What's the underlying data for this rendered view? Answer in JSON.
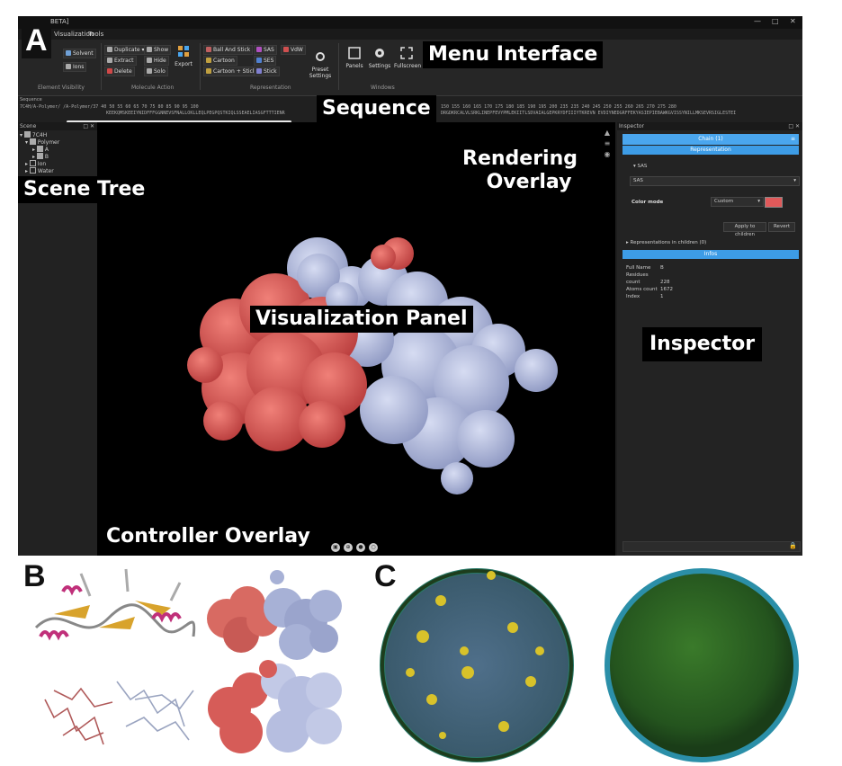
{
  "title_fragment": "BETA]",
  "menu": [
    "Visualization",
    "Tools"
  ],
  "ribbon": {
    "groups": [
      "Element Visibility",
      "Molecule Action",
      "Representation",
      "Windows"
    ],
    "element_visibility": [
      "Solvent",
      "Ions"
    ],
    "molecule_action": [
      "Duplicate",
      "Extract",
      "Delete",
      "Show",
      "Hide",
      "Solo",
      "Export"
    ],
    "representation": [
      "Ball And Stick",
      "Cartoon",
      "Cartoon + Stick",
      "SAS",
      "SES",
      "Stick",
      "VdW",
      "Preset Settings"
    ],
    "windows": [
      "Panels",
      "Settings",
      "Fullscreen"
    ]
  },
  "sequence": {
    "label": "Sequence",
    "chain_path": "7C4H/A-Polymer/ /A-Polymer/",
    "numbers_left": "37     40   50   55   60   65   70   75   80   85   90   95  100",
    "numbers_right": "150  155  160  165  170  175  180  185  190  195  200      235 235  240  245  250  255  260  265  270  275  280",
    "residues_left": "KEEKQMSKEEIYNIDFFFGGNNEVSFNALLOKLLEQLPEGPQSTKIQLSSEAELIASGFTTTIENR",
    "residues_right": "DRGDKRCALVLSRKLINEPFEVYPMLEKIITLSDVAIALGEPKRYDFIIIYTKREVN  EVDIYNEDGRFFEKYASIEPIEBAWKGVISSYNILLMKSEVRSIGLESTEI"
  },
  "scene": {
    "header": "Scene",
    "items": [
      {
        "label": "7C4H",
        "checked": true
      },
      {
        "label": "Polymer",
        "checked": true
      },
      {
        "label": "A",
        "checked": true
      },
      {
        "label": "B",
        "checked": true,
        "selected": true
      },
      {
        "label": "Ion",
        "checked": false
      },
      {
        "label": "Water",
        "checked": false
      }
    ]
  },
  "inspector": {
    "header": "Inspector",
    "chain": "Chain (1)",
    "representation_header": "Representation",
    "rep_name": "SAS",
    "rep_select": "SAS",
    "color_mode_label": "Color mode",
    "color_mode_value": "Custom",
    "color_swatch": "#e0595a",
    "apply_children": "Apply to children",
    "revert": "Revert",
    "reps_in_children": "Representations in children (0)",
    "info_header": "Infos",
    "info": [
      {
        "key": "Full Name",
        "value": "B"
      },
      {
        "key": "Residues count",
        "value": "228"
      },
      {
        "key": "Atoms count",
        "value": "1672"
      },
      {
        "key": "Index",
        "value": "1"
      }
    ]
  },
  "callouts": {
    "menu": "Menu Interface",
    "sequence": "Sequence",
    "rendering1": "Rendering",
    "rendering2": "Overlay",
    "scene": "Scene Tree",
    "viz": "Visualization Panel",
    "inspector": "Inspector",
    "controller": "Controller Overlay"
  },
  "panel_letters": [
    "A",
    "B",
    "C"
  ],
  "colors": {
    "protein_red": "#e0605c",
    "protein_blue": "#b4bedf",
    "accent": "#4aa6ee"
  }
}
